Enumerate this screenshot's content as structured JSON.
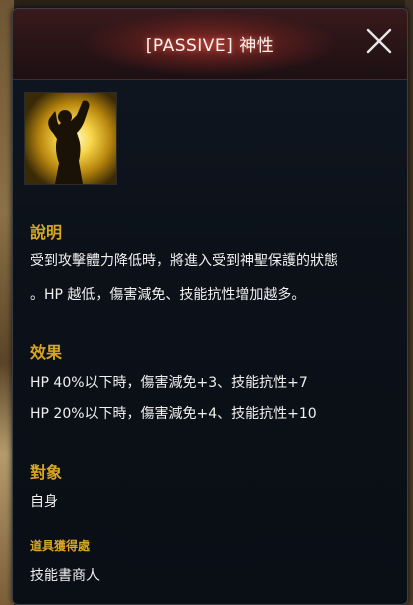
{
  "tooltip": {
    "title": "[PASSIVE] 神性",
    "close_icon": "close-icon"
  },
  "skill_icon": "praying-figure-light-icon",
  "colors": {
    "section_title": "#d8a624",
    "body_text": "#f0f0f0",
    "title_glow": "#d63f34"
  },
  "description": {
    "heading": "說明",
    "lines": [
      "受到攻擊體力降低時，將進入受到神聖保護的狀態",
      "。HP 越低，傷害減免、技能抗性增加越多。"
    ]
  },
  "effects": {
    "heading": "效果",
    "lines": [
      "HP 40%以下時，傷害減免+3、技能抗性+7",
      "HP 20%以下時，傷害減免+4、技能抗性+10"
    ]
  },
  "target": {
    "heading": "對象",
    "value": "自身"
  },
  "acquisition": {
    "heading": "道具獲得處",
    "value": "技能書商人"
  }
}
